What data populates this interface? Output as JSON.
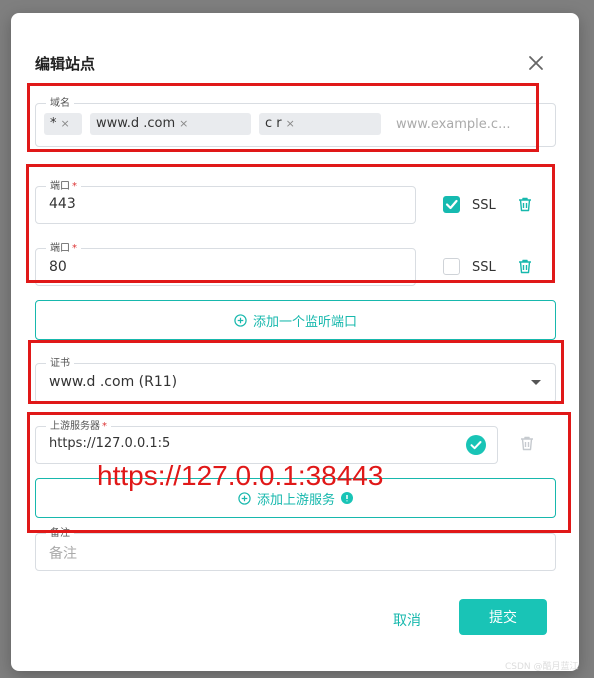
{
  "dialog": {
    "title": "编辑站点"
  },
  "domain_field": {
    "label": "域名",
    "chips": [
      "*",
      "www.d               .com",
      "c              r"
    ],
    "chip_remove_glyph": "×",
    "placeholder": "www.example.c..."
  },
  "ports": [
    {
      "label": "端口",
      "required_mark": "*",
      "value": "443",
      "ssl_label": "SSL",
      "ssl_checked": true
    },
    {
      "label": "端口",
      "required_mark": "*",
      "value": "80",
      "ssl_label": "SSL",
      "ssl_checked": false
    }
  ],
  "add_port_button": {
    "label": "添加一个监听端口"
  },
  "certificate": {
    "label": "证书",
    "value": "www.d          .com (R11)"
  },
  "upstream": {
    "label": "上游服务器",
    "required_mark": "*",
    "value": "https://127.0.0.1:5",
    "status": "valid"
  },
  "add_upstream_button": {
    "label": "添加上游服务"
  },
  "annotation_overlay": {
    "text": "https://127.0.0.1:38443"
  },
  "remark": {
    "label": "备注",
    "placeholder": "备注"
  },
  "footer": {
    "cancel_label": "取消",
    "submit_label": "提交"
  },
  "watermark": "CSDN @酷月蓝江",
  "colors": {
    "accent": "#17b8ad",
    "annotation_red": "#e01818",
    "chip_bg": "#e9ebee"
  }
}
